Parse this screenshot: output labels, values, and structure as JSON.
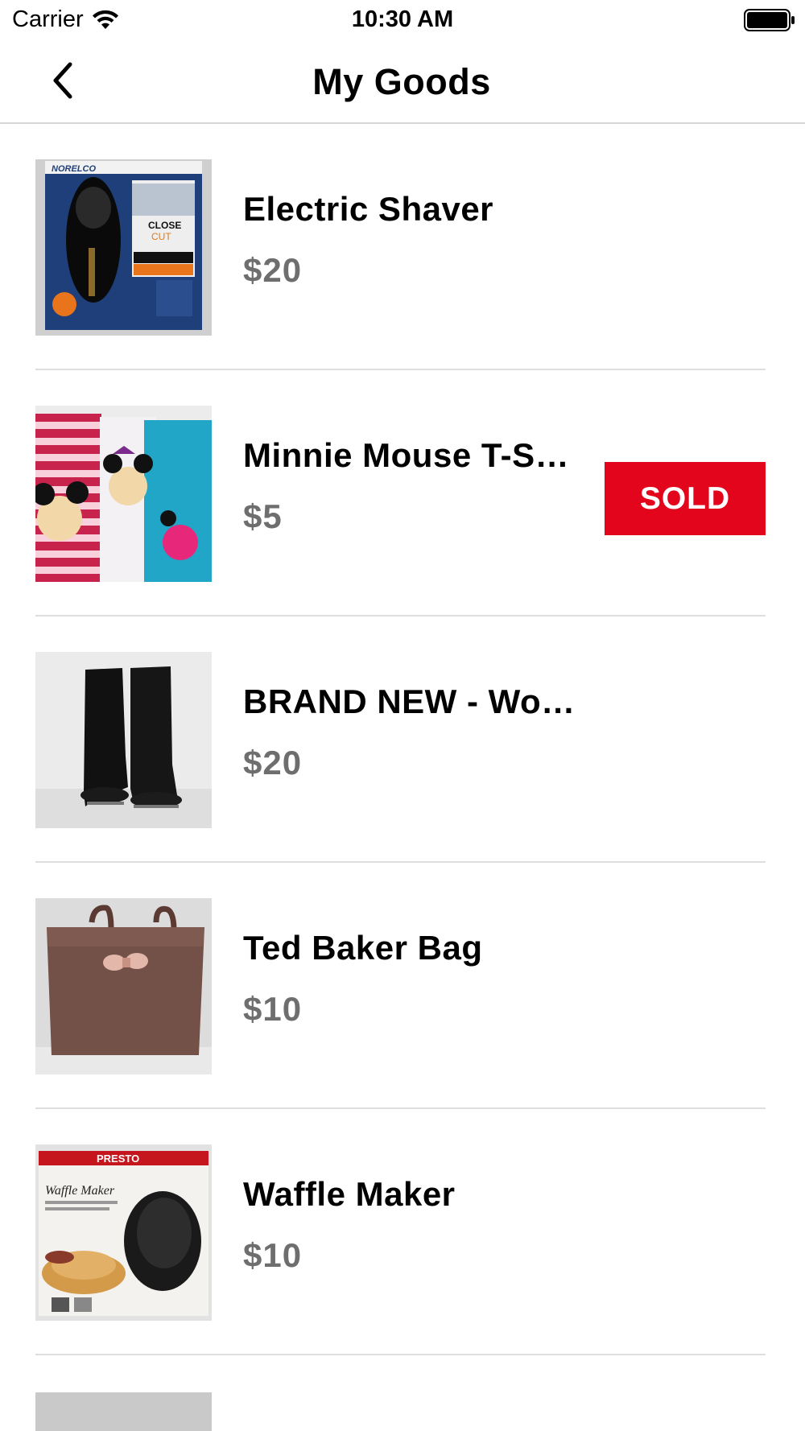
{
  "status_bar": {
    "carrier": "Carrier",
    "time": "10:30 AM",
    "wifi_icon": "wifi-icon",
    "battery_icon": "battery-icon"
  },
  "nav": {
    "title": "My Goods",
    "back_icon": "chevron-left-icon"
  },
  "colors": {
    "sold_badge": "#e3051b",
    "price_text": "#6e6e6e",
    "divider": "#dedede"
  },
  "items": [
    {
      "title": "Electric Shaver",
      "price": "$20",
      "sold": false,
      "image": "electric-shaver-photo"
    },
    {
      "title": "Minnie Mouse T-S…",
      "price": "$5",
      "sold": true,
      "sold_label": "SOLD",
      "image": "minnie-mouse-tshirts-photo"
    },
    {
      "title": "BRAND NEW - Wo…",
      "price": "$20",
      "sold": false,
      "image": "black-boots-photo"
    },
    {
      "title": "Ted Baker Bag",
      "price": "$10",
      "sold": false,
      "image": "ted-baker-bag-photo"
    },
    {
      "title": "Waffle Maker",
      "price": "$10",
      "sold": false,
      "image": "waffle-maker-photo"
    }
  ]
}
